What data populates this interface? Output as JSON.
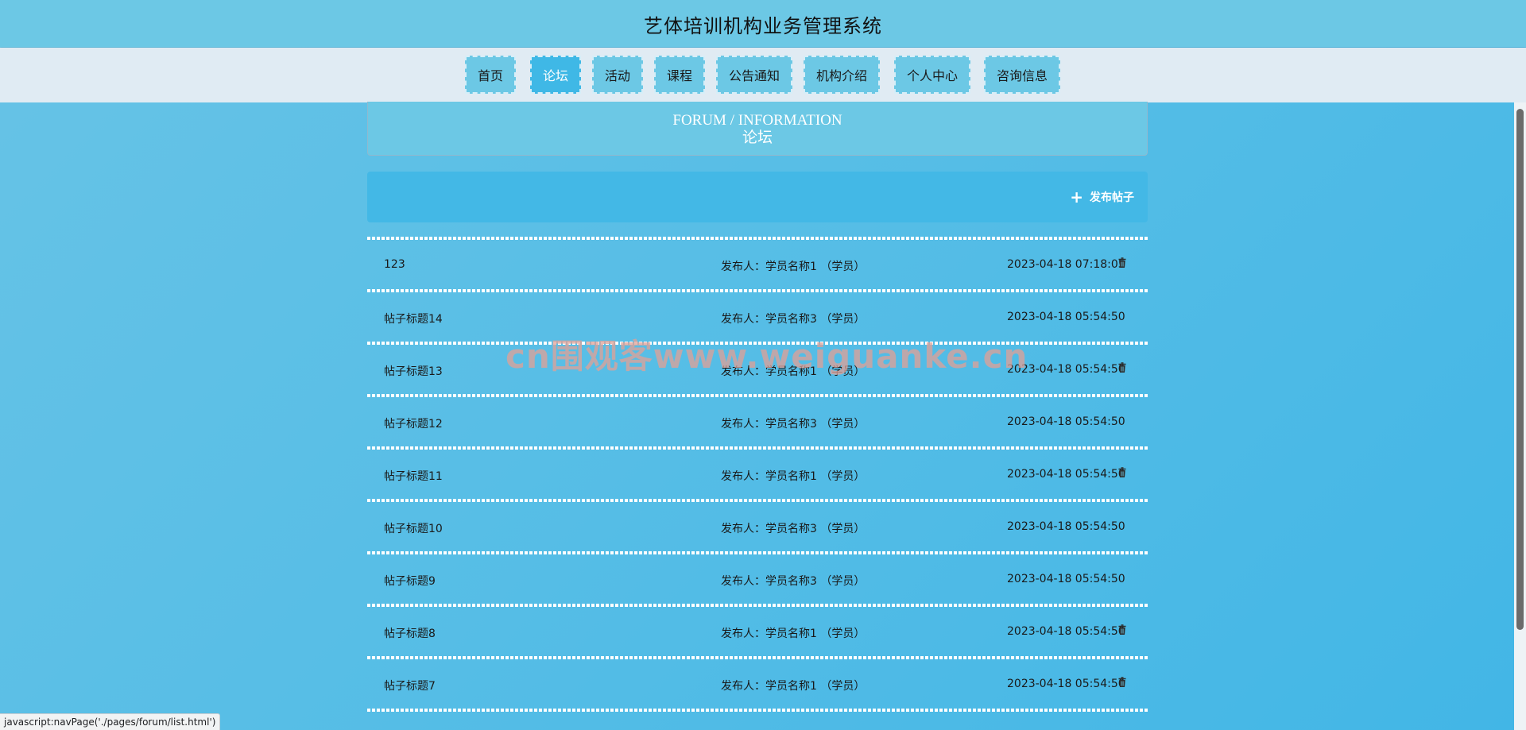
{
  "header": {
    "title": "艺体培训机构业务管理系统"
  },
  "nav": {
    "items": [
      {
        "label": "首页"
      },
      {
        "label": "论坛"
      },
      {
        "label": "活动"
      },
      {
        "label": "课程"
      },
      {
        "label": "公告通知"
      },
      {
        "label": "机构介绍"
      },
      {
        "label": "个人中心"
      },
      {
        "label": "咨询信息"
      }
    ],
    "active": "论坛"
  },
  "section": {
    "title_en": "FORUM / INFORMATION",
    "title_cn": "论坛"
  },
  "actions": {
    "post_label": "发布帖子"
  },
  "posts": [
    {
      "title": "123",
      "author": "发布人：学员名称1 （学员）",
      "date": "2023-04-18 07:18:05",
      "deletable": true
    },
    {
      "title": "帖子标题14",
      "author": "发布人：学员名称3 （学员）",
      "date": "2023-04-18 05:54:50",
      "deletable": false
    },
    {
      "title": "帖子标题13",
      "author": "发布人：学员名称1 （学员）",
      "date": "2023-04-18 05:54:50",
      "deletable": true
    },
    {
      "title": "帖子标题12",
      "author": "发布人：学员名称3 （学员）",
      "date": "2023-04-18 05:54:50",
      "deletable": false
    },
    {
      "title": "帖子标题11",
      "author": "发布人：学员名称1 （学员）",
      "date": "2023-04-18 05:54:50",
      "deletable": true
    },
    {
      "title": "帖子标题10",
      "author": "发布人：学员名称3 （学员）",
      "date": "2023-04-18 05:54:50",
      "deletable": false
    },
    {
      "title": "帖子标题9",
      "author": "发布人：学员名称3 （学员）",
      "date": "2023-04-18 05:54:50",
      "deletable": false
    },
    {
      "title": "帖子标题8",
      "author": "发布人：学员名称1 （学员）",
      "date": "2023-04-18 05:54:50",
      "deletable": true
    },
    {
      "title": "帖子标题7",
      "author": "发布人：学员名称1 （学员）",
      "date": "2023-04-18 05:54:50",
      "deletable": true
    }
  ],
  "watermark": {
    "text": "cn围观客www.weiguanke.cn"
  },
  "status_bar": {
    "url": "javascript:navPage('./pages/forum/list.html')"
  },
  "icons": {
    "delete": "trash-icon",
    "add": "plus-icon"
  },
  "colors": {
    "header": "#6cc8e5",
    "nav_bg": "#e0ebf3",
    "nav_active": "#3fb8e6",
    "action_bar": "#43b8e6"
  }
}
